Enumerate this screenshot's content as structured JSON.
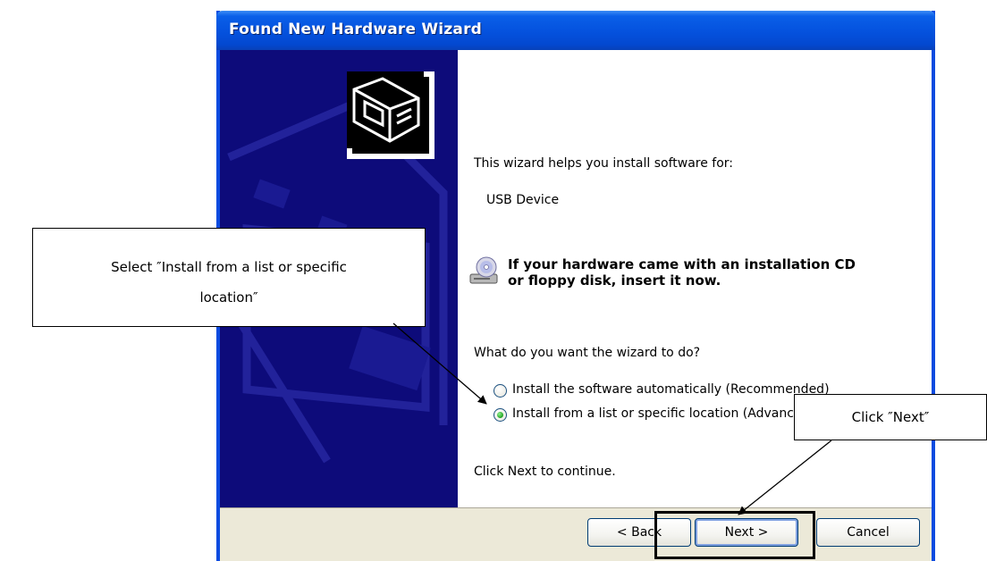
{
  "window": {
    "title": "Found New Hardware Wizard"
  },
  "content": {
    "intro": "This wizard helps you install software for:",
    "device_name": "USB Device",
    "cd_prompt_line1": "If your hardware came with an installation CD",
    "cd_prompt_line2": "or floppy disk, insert it now.",
    "question": "What do you want the wizard to do?",
    "options": [
      {
        "label": "Install the software automatically (Recommended)",
        "selected": false
      },
      {
        "label": "Install from a list or specific location (Advanced)",
        "selected": true
      }
    ],
    "continue_hint": "Click Next to continue."
  },
  "buttons": {
    "back": "< Back",
    "next": "Next >",
    "cancel": "Cancel"
  },
  "annotations": {
    "select_note_line1": "Select ″Install from a list or specific",
    "select_note_line2": "location″",
    "click_note": "Click ″Next″"
  },
  "colors": {
    "title_bar": "#0553df",
    "side_panel": "#0d0b7a",
    "dialog_bg": "#ece9d8"
  }
}
